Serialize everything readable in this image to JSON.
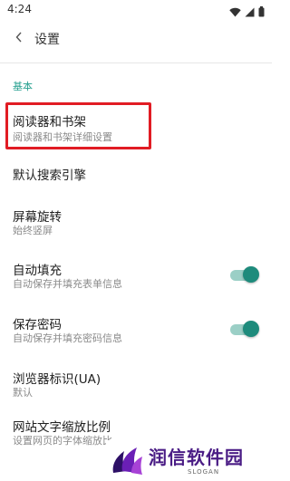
{
  "status_bar": {
    "time": "4:24"
  },
  "app_bar": {
    "title": "设置"
  },
  "section": {
    "header": "基本"
  },
  "items": [
    {
      "title": "阅读器和书架",
      "subtitle": "阅读器和书架详细设置"
    },
    {
      "title": "默认搜索引擎"
    },
    {
      "title": "屏幕旋转",
      "subtitle": "始终竖屏"
    },
    {
      "title": "自动填充",
      "subtitle": "自动保存并填充表单信息",
      "toggle_on": true
    },
    {
      "title": "保存密码",
      "subtitle": "自动保存并填充密码信息",
      "toggle_on": true
    },
    {
      "title": "浏览器标识(UA)",
      "subtitle": "默认"
    },
    {
      "title": "网站文字缩放比例",
      "subtitle": "设置网页的字体缩放比"
    }
  ],
  "watermark": {
    "text": "润信软件园",
    "slogan": "SLOGAN"
  },
  "colors": {
    "accent": "#26a08f",
    "toggle_thumb": "#1e8b7c",
    "highlight": "#e11c24",
    "watermark": "#4a1c85"
  },
  "icons": [
    "wifi-icon",
    "cellular-signal-icon",
    "battery-icon",
    "back-arrow-icon"
  ]
}
